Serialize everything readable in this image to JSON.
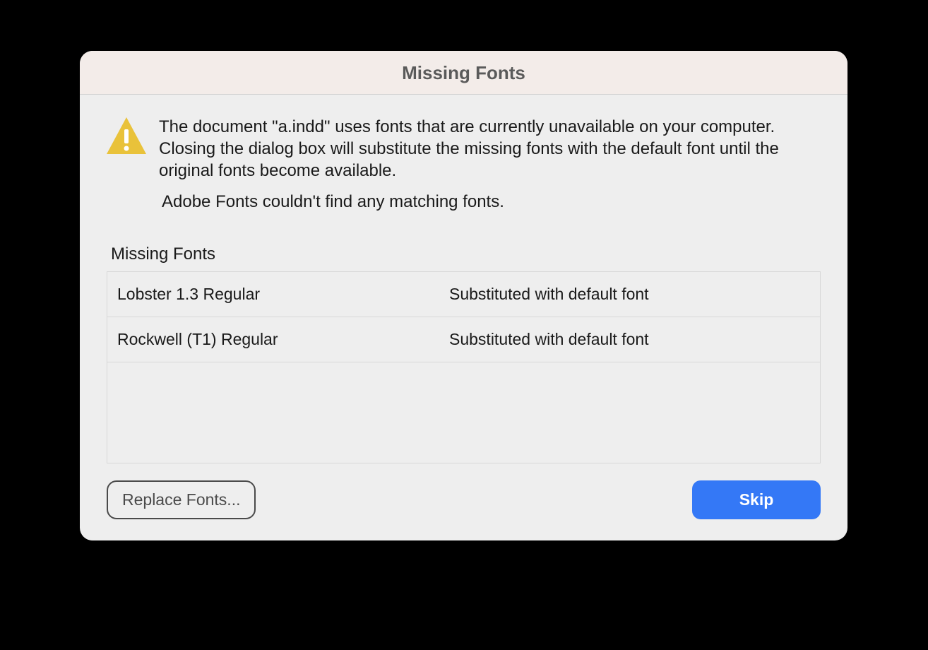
{
  "dialog": {
    "title": "Missing Fonts",
    "warning_message": "The document \"a.indd\" uses fonts that are currently unavailable on your computer. Closing the dialog box will substitute the missing fonts with the default font until the original fonts become available.",
    "adobe_fonts_message": "Adobe Fonts couldn't find any matching fonts.",
    "section_label": "Missing Fonts",
    "fonts": [
      {
        "name": "Lobster 1.3 Regular",
        "status": "Substituted with default font"
      },
      {
        "name": "Rockwell (T1) Regular",
        "status": "Substituted with default font"
      }
    ],
    "buttons": {
      "replace": "Replace Fonts...",
      "skip": "Skip"
    }
  }
}
